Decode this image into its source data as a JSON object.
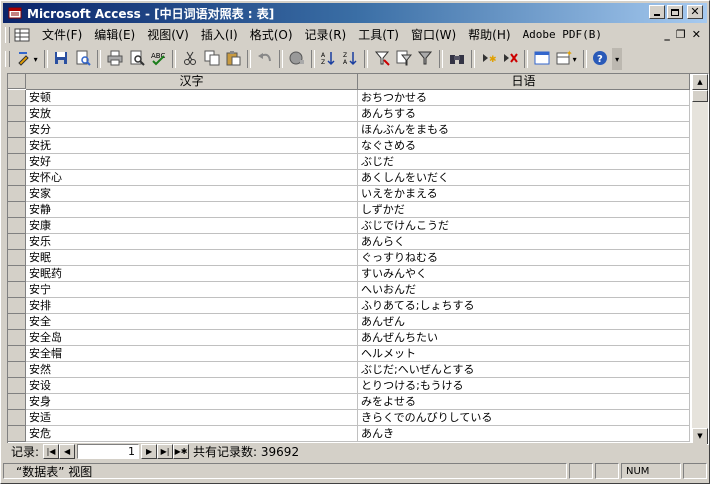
{
  "window": {
    "title": "Microsoft Access - [中日词语对照表 : 表]"
  },
  "menu": {
    "items": [
      {
        "label": "文件(F)",
        "name": "menu-file"
      },
      {
        "label": "编辑(E)",
        "name": "menu-edit"
      },
      {
        "label": "视图(V)",
        "name": "menu-view"
      },
      {
        "label": "插入(I)",
        "name": "menu-insert"
      },
      {
        "label": "格式(O)",
        "name": "menu-format"
      },
      {
        "label": "记录(R)",
        "name": "menu-records"
      },
      {
        "label": "工具(T)",
        "name": "menu-tools"
      },
      {
        "label": "窗口(W)",
        "name": "menu-window"
      },
      {
        "label": "帮助(H)",
        "name": "menu-help"
      },
      {
        "label": "Adobe PDF(B)",
        "name": "menu-adobe-pdf"
      }
    ]
  },
  "table": {
    "columns": [
      "汉字",
      "日语"
    ],
    "rows": [
      [
        "安顿",
        "おちつかせる"
      ],
      [
        "安放",
        "あんちする"
      ],
      [
        "安分",
        "ほんぶんをまもる"
      ],
      [
        "安抚",
        "なぐさめる"
      ],
      [
        "安好",
        "ぶじだ"
      ],
      [
        "安怀心",
        "あくしんをいだく"
      ],
      [
        "安家",
        "いえをかまえる"
      ],
      [
        "安静",
        "しずかだ"
      ],
      [
        "安康",
        "ぶじでけんこうだ"
      ],
      [
        "安乐",
        "あんらく"
      ],
      [
        "安眠",
        "ぐっすりねむる"
      ],
      [
        "安眠药",
        "すいみんやく"
      ],
      [
        "安宁",
        "へいおんだ"
      ],
      [
        "安排",
        "ふりあてる;しょちする"
      ],
      [
        "安全",
        "あんぜん"
      ],
      [
        "安全岛",
        "あんぜんちたい"
      ],
      [
        "安全帽",
        "ヘルメット"
      ],
      [
        "安然",
        "ぶじだ;へいぜんとする"
      ],
      [
        "安设",
        "とりつける;もうける"
      ],
      [
        "安身",
        "みをよせる"
      ],
      [
        "安适",
        "きらくでのんびりしている"
      ],
      [
        "安危",
        "あんき"
      ]
    ]
  },
  "nav": {
    "label": "记录:",
    "current": "1",
    "total_text": "共有记录数: 39692"
  },
  "status": {
    "text": "“数据表” 视图",
    "num": "NUM"
  },
  "colors": {
    "title_start": "#0a246a",
    "title_end": "#a6caf0",
    "face": "#d4d0c8"
  }
}
